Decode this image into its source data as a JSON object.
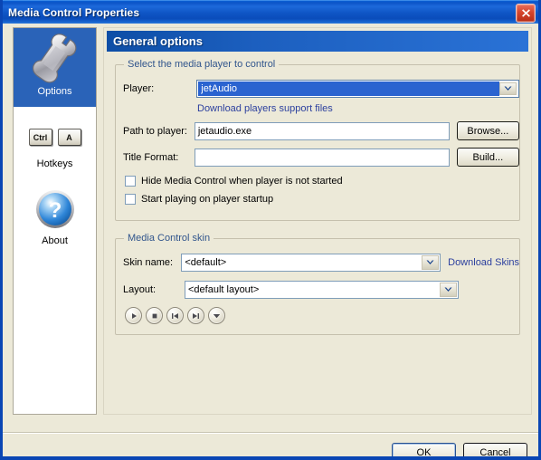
{
  "window": {
    "title": "Media Control Properties",
    "close_icon": "close-icon",
    "accent": "#0a46b4",
    "face": "#ece9d8"
  },
  "sidebar": {
    "items": [
      {
        "label": "Options",
        "icon": "wrench-icon",
        "selected": true
      },
      {
        "label": "Hotkeys",
        "icon": "ctrl-a-keycaps-icon",
        "selected": false
      },
      {
        "label": "About",
        "icon": "question-mark-icon",
        "selected": false
      }
    ],
    "keycaps": {
      "ctrl": "Ctrl",
      "a": "A"
    }
  },
  "panel": {
    "header": "General options",
    "player_group": {
      "title": "Select the media player to control",
      "player_label": "Player:",
      "player_value": "jetAudio",
      "player_selected": true,
      "download_link": "Download players support files",
      "path_label": "Path to player:",
      "path_value": "jetaudio.exe",
      "path_placeholder": "",
      "browse_button": "Browse...",
      "title_format_label": "Title Format:",
      "title_format_value": "",
      "title_format_placeholder": "",
      "build_button": "Build...",
      "checkbox_hide": {
        "label": "Hide Media Control when player is not started",
        "checked": false
      },
      "checkbox_autoplay": {
        "label": "Start playing on player startup",
        "checked": false
      }
    },
    "skin_group": {
      "title": "Media Control skin",
      "skin_label": "Skin name:",
      "skin_value": "<default>",
      "download_skins_link": "Download Skins",
      "layout_label": "Layout:",
      "layout_value": "<default layout>",
      "transport_buttons": [
        {
          "name": "play-icon"
        },
        {
          "name": "stop-icon"
        },
        {
          "name": "previous-track-icon"
        },
        {
          "name": "next-track-icon"
        },
        {
          "name": "chevron-down-icon"
        }
      ]
    }
  },
  "footer": {
    "ok_label": "OK",
    "cancel_label": "Cancel"
  }
}
